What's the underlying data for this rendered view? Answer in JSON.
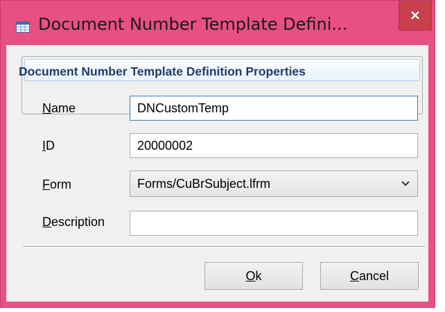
{
  "window": {
    "title": "Document Number Template Defini...",
    "icon": "table-icon",
    "close_icon": "close-icon",
    "frame_color": "#e84f84",
    "close_color": "#c7404a"
  },
  "group": {
    "title": "Document Number Template Definition Properties",
    "title_color": "#1f3c6e"
  },
  "fields": {
    "name": {
      "label_mnemonic": "N",
      "label_rest": "ame",
      "value": "DNCustomTemp"
    },
    "id": {
      "label_mnemonic": "I",
      "label_rest": "D",
      "value": "20000002"
    },
    "form": {
      "label_mnemonic": "F",
      "label_rest": "orm",
      "value": "Forms/CuBrSubject.lfrm",
      "arrow_icon": "chevron-down-icon"
    },
    "description": {
      "label_mnemonic": "D",
      "label_rest": "escription",
      "value": ""
    }
  },
  "buttons": {
    "ok": {
      "mnemonic": "O",
      "rest": "k"
    },
    "cancel": {
      "mnemonic": "C",
      "rest": "ancel"
    }
  }
}
